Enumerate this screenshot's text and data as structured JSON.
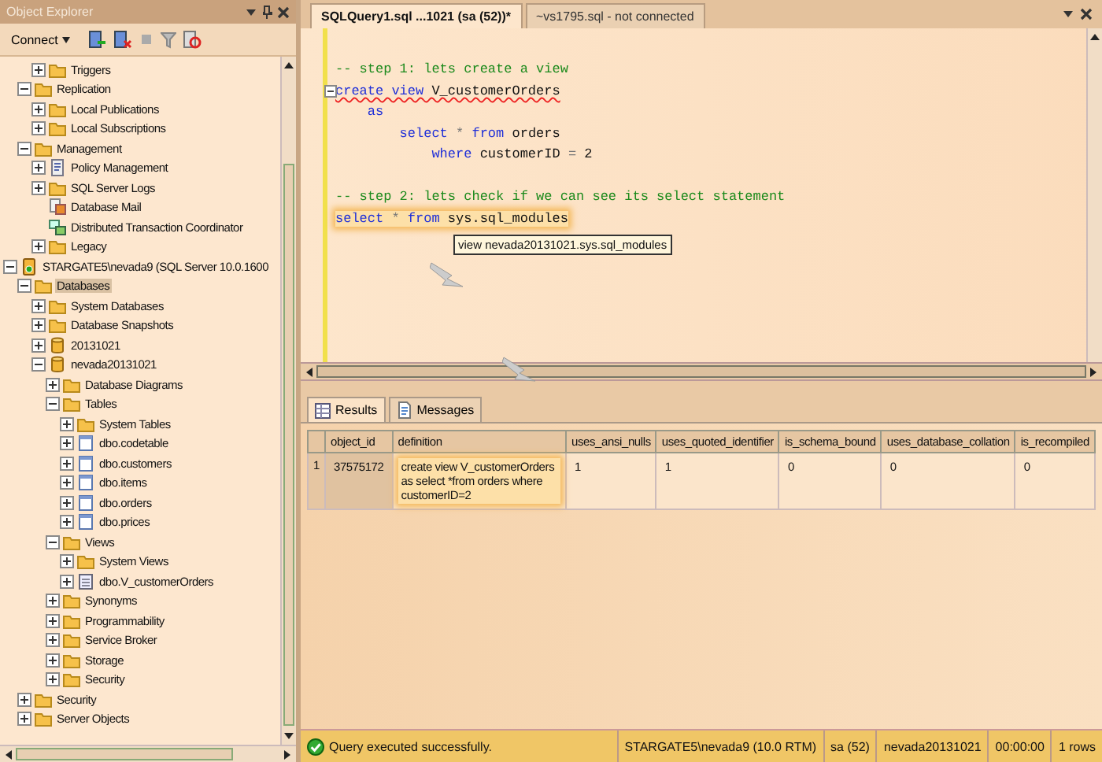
{
  "object_explorer": {
    "title": "Object Explorer",
    "connect_label": "Connect",
    "tree": [
      {
        "children": [
          {
            "children": [
              {
                "label": "Triggers",
                "kind": "folder",
                "expanded": false,
                "selected": false
              }
            ]
          },
          {
            "label": "Replication",
            "kind": "folder",
            "expanded": true,
            "selected": false,
            "children": [
              {
                "label": "Local Publications",
                "kind": "folder",
                "expanded": false,
                "selected": false
              },
              {
                "label": "Local Subscriptions",
                "kind": "folder",
                "expanded": false,
                "selected": false
              }
            ]
          },
          {
            "label": "Management",
            "kind": "folder",
            "expanded": true,
            "selected": false,
            "children": [
              {
                "label": "Policy Management",
                "kind": "policy",
                "expanded": false,
                "selected": false
              },
              {
                "label": "SQL Server Logs",
                "kind": "folder",
                "expanded": false,
                "selected": false
              },
              {
                "label": "Database Mail",
                "kind": "mail",
                "selected": false
              },
              {
                "label": "Distributed Transaction Coordinator",
                "kind": "coordinator",
                "selected": false
              },
              {
                "label": "Legacy",
                "kind": "folder",
                "expanded": false,
                "selected": false
              }
            ]
          }
        ]
      },
      {
        "label": "STARGATE5\\nevada9 (SQL Server 10.0.1600",
        "kind": "server",
        "expanded": true,
        "selected": false,
        "children": [
          {
            "label": "Databases",
            "kind": "folder",
            "expanded": true,
            "selected": true,
            "children": [
              {
                "label": "System Databases",
                "kind": "folder",
                "expanded": false,
                "selected": false
              },
              {
                "label": "Database Snapshots",
                "kind": "folder",
                "expanded": false,
                "selected": false
              },
              {
                "label": "20131021",
                "kind": "database",
                "expanded": false,
                "selected": false
              },
              {
                "label": "nevada20131021",
                "kind": "database",
                "expanded": true,
                "selected": false,
                "children": [
                  {
                    "label": "Database Diagrams",
                    "kind": "folder",
                    "expanded": false,
                    "selected": false
                  },
                  {
                    "label": "Tables",
                    "kind": "folder",
                    "expanded": true,
                    "selected": false,
                    "children": [
                      {
                        "label": "System Tables",
                        "kind": "folder",
                        "expanded": false,
                        "selected": false
                      },
                      {
                        "label": "dbo.codetable",
                        "kind": "table",
                        "expanded": false,
                        "selected": false
                      },
                      {
                        "label": "dbo.customers",
                        "kind": "table",
                        "expanded": false,
                        "selected": false
                      },
                      {
                        "label": "dbo.items",
                        "kind": "table",
                        "expanded": false,
                        "selected": false
                      },
                      {
                        "label": "dbo.orders",
                        "kind": "table",
                        "expanded": false,
                        "selected": false
                      },
                      {
                        "label": "dbo.prices",
                        "kind": "table",
                        "expanded": false,
                        "selected": false
                      }
                    ]
                  },
                  {
                    "label": "Views",
                    "kind": "folder",
                    "expanded": true,
                    "selected": false,
                    "children": [
                      {
                        "label": "System Views",
                        "kind": "folder",
                        "expanded": false,
                        "selected": false
                      },
                      {
                        "label": "dbo.V_customerOrders",
                        "kind": "view",
                        "expanded": false,
                        "selected": false
                      }
                    ]
                  },
                  {
                    "label": "Synonyms",
                    "kind": "folder",
                    "expanded": false,
                    "selected": false
                  },
                  {
                    "label": "Programmability",
                    "kind": "folder",
                    "expanded": false,
                    "selected": false
                  },
                  {
                    "label": "Service Broker",
                    "kind": "folder",
                    "expanded": false,
                    "selected": false
                  },
                  {
                    "label": "Storage",
                    "kind": "folder",
                    "expanded": false,
                    "selected": false
                  },
                  {
                    "label": "Security",
                    "kind": "folder",
                    "expanded": false,
                    "selected": false
                  }
                ]
              }
            ]
          },
          {
            "label": "Security",
            "kind": "folder",
            "expanded": false,
            "selected": false
          },
          {
            "label": "Server Objects",
            "kind": "folder",
            "expanded": false,
            "selected": false
          }
        ]
      }
    ]
  },
  "editor_tabs": [
    {
      "label": "SQLQuery1.sql ...1021 (sa (52))*",
      "selected": true
    },
    {
      "label": "~vs1795.sql - not connected",
      "selected": false
    }
  ],
  "editor": {
    "lines": [
      {
        "kind": "blank"
      },
      {
        "kind": "code",
        "foldable": false,
        "error": false,
        "highlighted": false,
        "tokens": [
          {
            "kind": "comment",
            "text": "-- step 1: lets create a view"
          }
        ]
      },
      {
        "kind": "code",
        "foldable": true,
        "error": true,
        "highlighted": false,
        "tokens": [
          {
            "kind": "keyword",
            "text": "create view"
          },
          {
            "kind": "plain",
            "text": " V_customerOrders"
          }
        ]
      },
      {
        "kind": "code",
        "foldable": false,
        "error": false,
        "highlighted": false,
        "tokens": [
          {
            "kind": "keyword",
            "text": "    as"
          }
        ]
      },
      {
        "kind": "code",
        "foldable": false,
        "error": false,
        "highlighted": false,
        "tokens": [
          {
            "kind": "keyword",
            "text": "        select"
          },
          {
            "kind": "operator",
            "text": " * "
          },
          {
            "kind": "keyword",
            "text": "from"
          },
          {
            "kind": "plain",
            "text": " orders"
          }
        ]
      },
      {
        "kind": "code",
        "foldable": false,
        "error": false,
        "highlighted": false,
        "tokens": [
          {
            "kind": "keyword",
            "text": "            where"
          },
          {
            "kind": "plain",
            "text": " customerID "
          },
          {
            "kind": "operator",
            "text": "="
          },
          {
            "kind": "plain",
            "text": " 2"
          }
        ]
      },
      {
        "kind": "blank"
      },
      {
        "kind": "code",
        "foldable": false,
        "error": false,
        "highlighted": false,
        "tokens": [
          {
            "kind": "comment",
            "text": "-- step 2: lets check if we can see its select statement"
          }
        ]
      },
      {
        "kind": "code",
        "foldable": false,
        "error": false,
        "highlighted": true,
        "tokens": [
          {
            "kind": "keyword",
            "text": "select"
          },
          {
            "kind": "operator",
            "text": " * "
          },
          {
            "kind": "keyword",
            "text": "from"
          },
          {
            "kind": "plain",
            "text": " sys.sql_modules"
          }
        ]
      }
    ],
    "tooltip": "view nevada20131021.sys.sql_modules"
  },
  "results_tabs": [
    {
      "label": "Results",
      "kind": "grid",
      "selected": true
    },
    {
      "label": "Messages",
      "kind": "messages",
      "selected": false
    }
  ],
  "results": {
    "columns": [
      "object_id",
      "definition",
      "uses_ansi_nulls",
      "uses_quoted_identifier",
      "is_schema_bound",
      "uses_database_collation",
      "is_recompiled"
    ],
    "rows": [
      {
        "number": "1",
        "cells": [
          {
            "text": "37575172",
            "highlighted": false
          },
          {
            "text": "create view V_customerOrders  as    select *from orders    where customerID=2",
            "highlighted": true
          },
          {
            "text": "1",
            "highlighted": false
          },
          {
            "text": "1",
            "highlighted": false
          },
          {
            "text": "0",
            "highlighted": false
          },
          {
            "text": "0",
            "highlighted": false
          },
          {
            "text": "0",
            "highlighted": false
          }
        ]
      }
    ]
  },
  "status_bar": {
    "message": "Query executed successfully.",
    "segments": [
      "STARGATE5\\nevada9 (10.0 RTM)",
      "sa (52)",
      "nevada20131021",
      "00:00:00",
      "1 rows"
    ]
  }
}
